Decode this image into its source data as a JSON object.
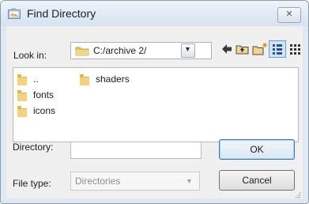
{
  "window": {
    "title": "Find Directory",
    "close_label": "✕"
  },
  "toolbar": {
    "look_in_label": "Look in:",
    "path_value": "C:/archive 2/",
    "icons": [
      "back-arrow-icon",
      "folder-up-icon",
      "new-folder-icon",
      "list-view-icon",
      "detail-view-icon"
    ]
  },
  "file_list": {
    "items": [
      {
        "name": "..",
        "icon": "folder-icon"
      },
      {
        "name": "fonts",
        "icon": "folder-icon"
      },
      {
        "name": "icons",
        "icon": "folder-icon"
      },
      {
        "name": "shaders",
        "icon": "folder-icon"
      }
    ]
  },
  "directory": {
    "label": "Directory:",
    "value": ""
  },
  "file_type": {
    "label": "File type:",
    "value": "Directories"
  },
  "buttons": {
    "ok": "OK",
    "cancel": "Cancel"
  },
  "colors": {
    "title_bar": "#dfe8f3",
    "client_bg": "#f0f0f0",
    "ok_border": "#3c7fb1",
    "folder": "#e0b24a"
  }
}
